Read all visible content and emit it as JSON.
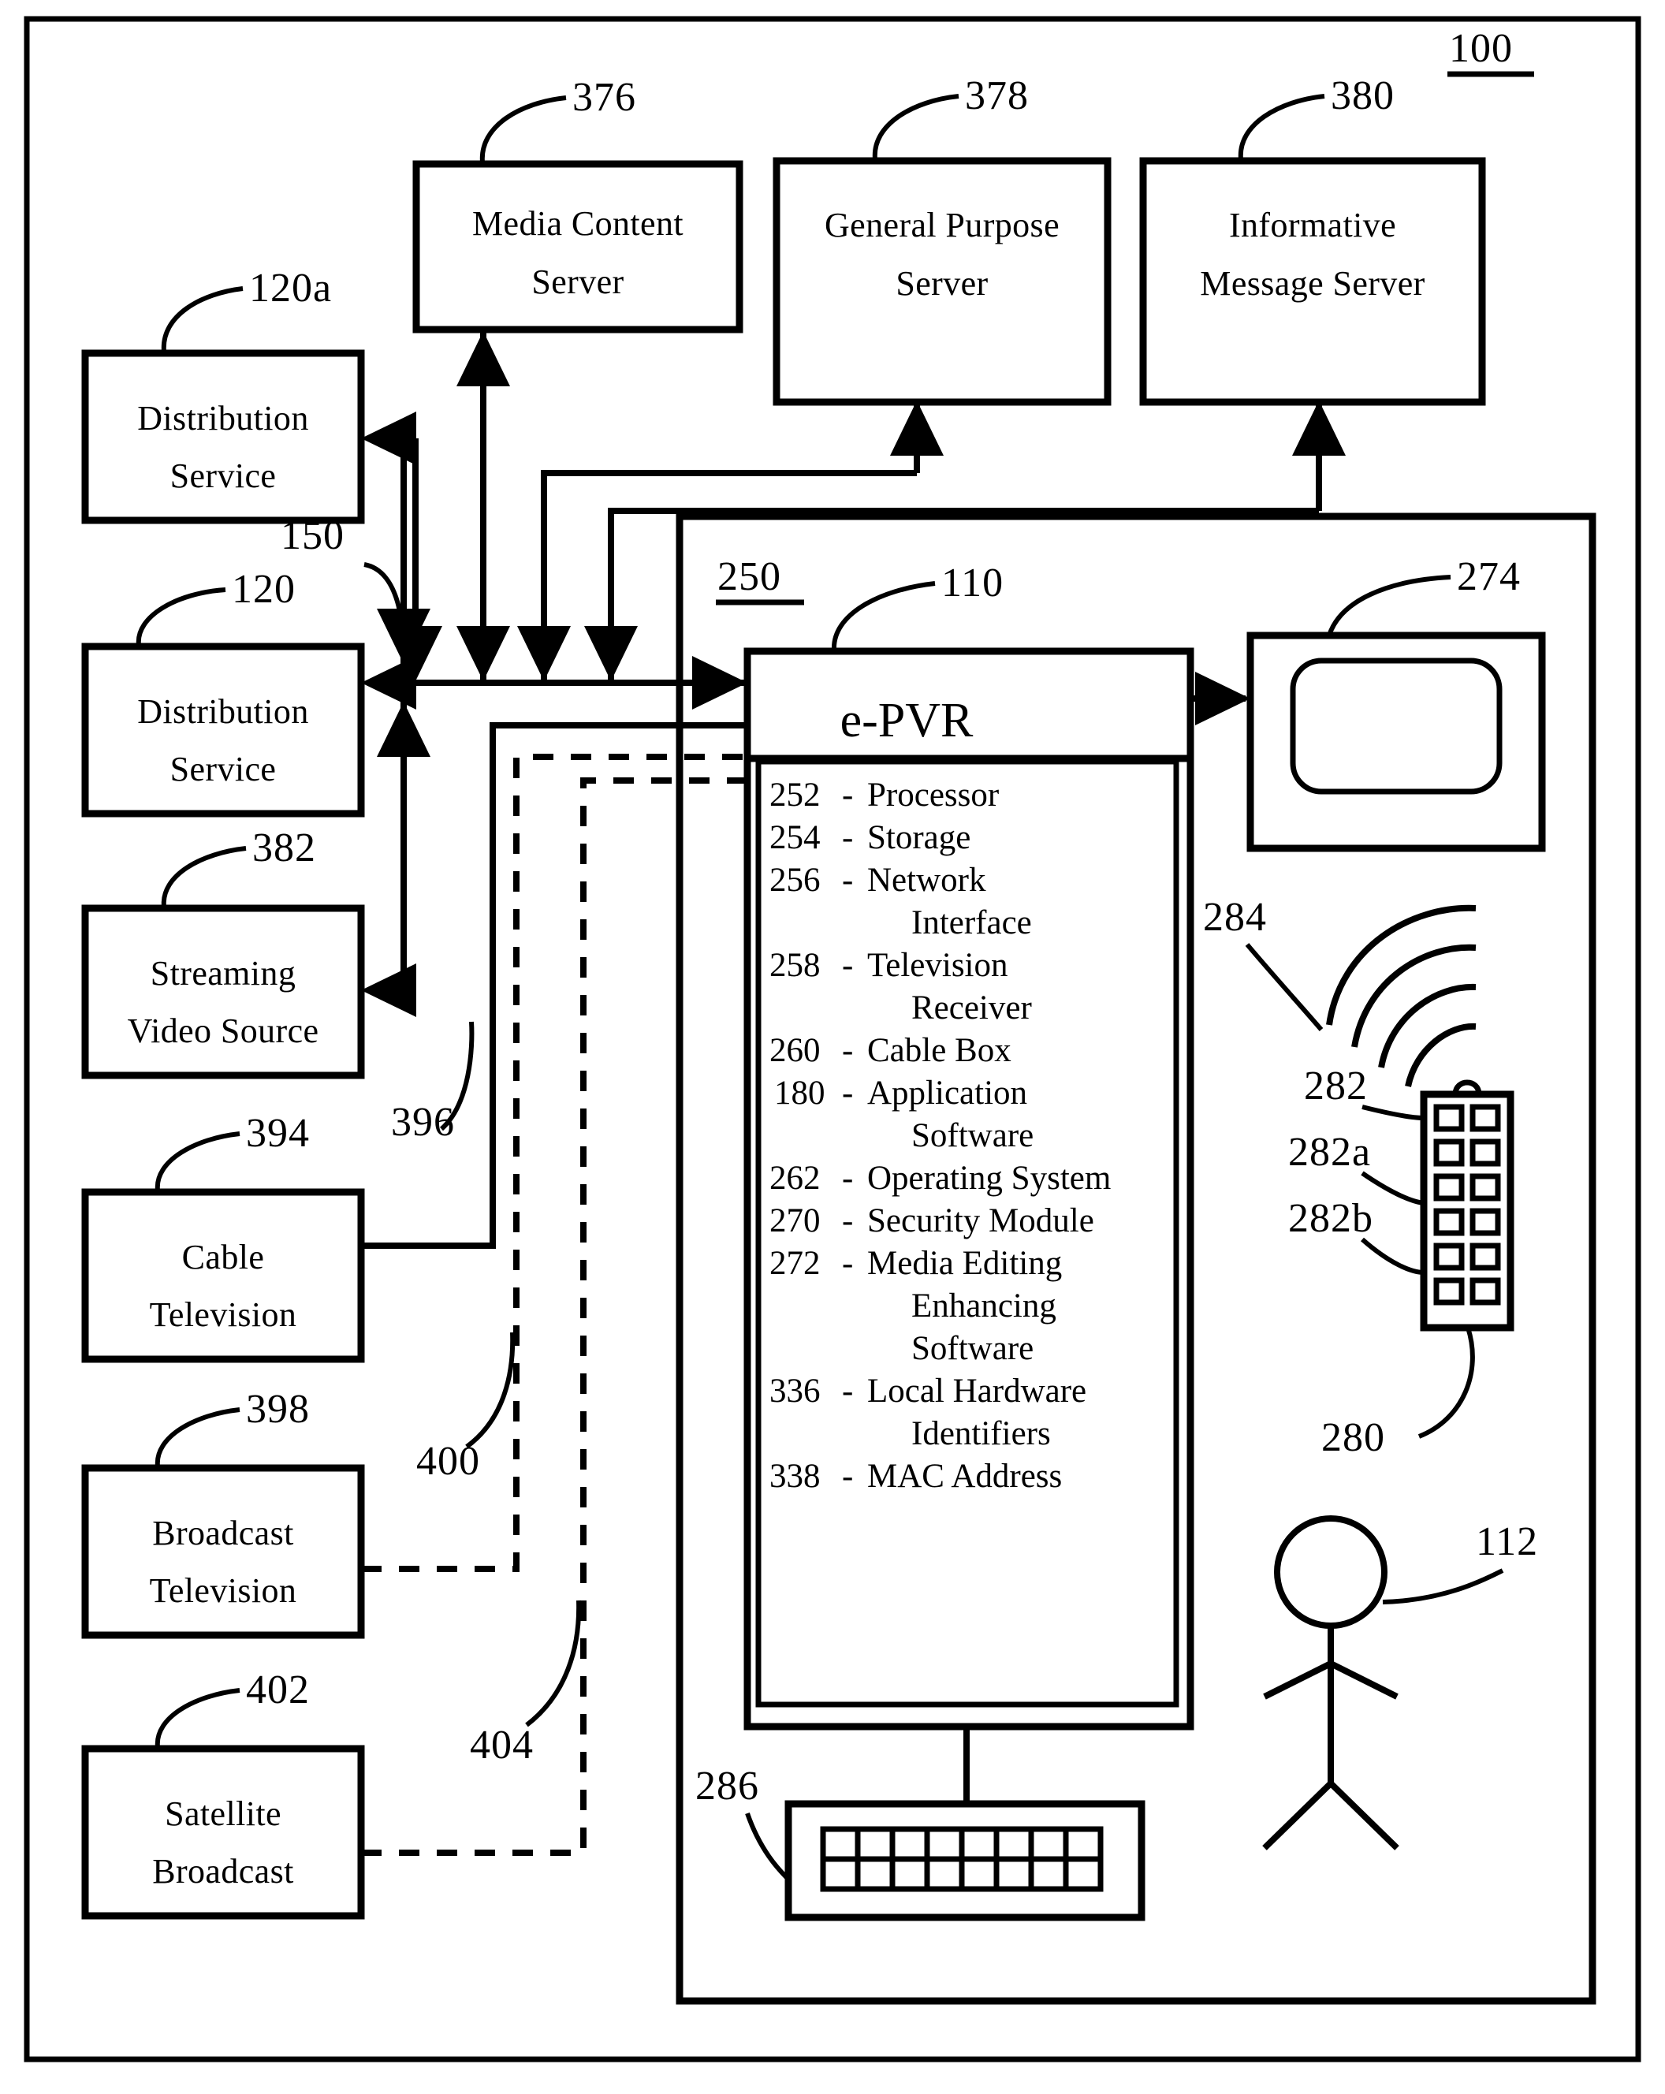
{
  "figure": {
    "system_ref": "100",
    "inner_panel_ref": "250"
  },
  "servers": [
    {
      "label_line1": "Media Content",
      "label_line2": "Server",
      "ref": "376"
    },
    {
      "label_line1": "General Purpose",
      "label_line2": "Server",
      "ref": "378"
    },
    {
      "label_line1": "Informative",
      "label_line2": "Message Server",
      "ref": "380"
    }
  ],
  "sources": [
    {
      "label_line1": "Distribution",
      "label_line2": "Service",
      "ref": "120a"
    },
    {
      "label_line1": "Distribution",
      "label_line2": "Service",
      "ref": "120"
    },
    {
      "label_line1": "Streaming",
      "label_line2": "Video Source",
      "ref": "382"
    },
    {
      "label_line1": "Cable",
      "label_line2": "Television",
      "ref": "394"
    },
    {
      "label_line1": "Broadcast",
      "label_line2": "Television",
      "ref": "398"
    },
    {
      "label_line1": "Satellite",
      "label_line2": "Broadcast",
      "ref": "402"
    }
  ],
  "connections": {
    "network_ref": "150",
    "cable_link_ref": "396",
    "broadcast_link_ref": "400",
    "satellite_link_ref": "404"
  },
  "epvr": {
    "title": "e-PVR",
    "ref": "110",
    "components": [
      {
        "num": "252",
        "name": "Processor",
        "cont": ""
      },
      {
        "num": "254",
        "name": "Storage",
        "cont": ""
      },
      {
        "num": "256",
        "name": "Network",
        "cont": "Interface"
      },
      {
        "num": "258",
        "name": "Television",
        "cont": "Receiver"
      },
      {
        "num": "260",
        "name": "Cable Box",
        "cont": ""
      },
      {
        "num": "180",
        "name": "Application",
        "cont": "Software"
      },
      {
        "num": "262",
        "name": "Operating System",
        "cont": ""
      },
      {
        "num": "270",
        "name": "Security Module",
        "cont": ""
      },
      {
        "num": "272",
        "name": "Media Editing",
        "cont": "Enhancing",
        "cont2": "Software"
      },
      {
        "num": "336",
        "name": "Local Hardware",
        "cont": "Identifiers"
      },
      {
        "num": "338",
        "name": "MAC Address",
        "cont": ""
      }
    ]
  },
  "peripherals": {
    "display_ref": "274",
    "signal_ref": "284",
    "remote_ref": "280",
    "buttons_ref": "282",
    "button_a_ref": "282a",
    "button_b_ref": "282b",
    "keyboard_ref": "286",
    "user_ref": "112"
  }
}
